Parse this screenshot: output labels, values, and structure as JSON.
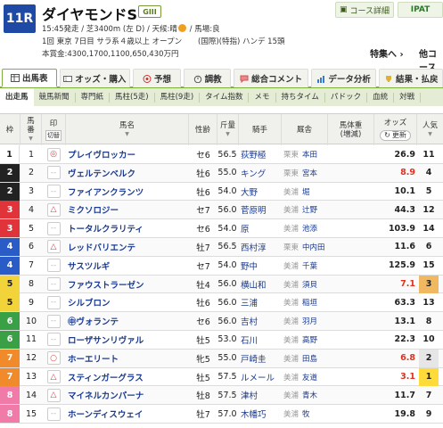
{
  "race": {
    "number": "11R",
    "name": "ダイヤモンドS",
    "grade": "GIII",
    "post_time": "15:45発走",
    "course": "芝3400m (左 D)",
    "weather_label": "天候:晴",
    "track": "馬場:良",
    "meeting": "1回 東京 7日目 サラ系４歳以上 オープン",
    "conditions": "(国際)(特指) ハンデ 15頭",
    "prize": "本賞金:4300,1700,1100,650,430万円"
  },
  "buttons": {
    "course_detail": "コース詳細",
    "ipat": "IPAT",
    "special_link": "特集へ",
    "results_link": "他コース"
  },
  "tabs": [
    {
      "label": "出馬表",
      "icon": "table-icon"
    },
    {
      "label": "オッズ・購入",
      "icon": "ticket-icon"
    },
    {
      "label": "予想",
      "icon": "target-icon"
    },
    {
      "label": "調教",
      "icon": "stopwatch-icon"
    },
    {
      "label": "総合コメント",
      "icon": "comment-icon"
    },
    {
      "label": "データ分析",
      "icon": "chart-icon"
    },
    {
      "label": "結果・払戻",
      "icon": "trophy-icon"
    }
  ],
  "subtabs": [
    "出走馬",
    "競馬新聞",
    "専門紙",
    "馬柱(5走)",
    "馬柱(9走)",
    "タイム指数",
    "メモ",
    "持ちタイム",
    "パドック",
    "血統",
    "対戦"
  ],
  "columns": {
    "waku": "枠",
    "umaban": "馬番",
    "mark": "印",
    "mark_sub": "切替",
    "horse": "馬名",
    "sex_age": "性齢",
    "weight_carried": "斤量",
    "jockey": "騎手",
    "trainer": "厩舎",
    "body_weight": "馬体重",
    "body_weight_sub": "(増減)",
    "odds": "オッズ",
    "update": "更新",
    "popularity": "人気"
  },
  "waku_colors": {
    "1": "#ffffff",
    "2": "#222222",
    "3": "#e0333a",
    "4": "#2a5cc8",
    "5": "#f2d43a",
    "6": "#3aa046",
    "7": "#f08a2a",
    "8": "#f07aa8"
  },
  "horses": [
    {
      "waku": "1",
      "uma": "1",
      "mark": "◎",
      "name": "プレイヴロッカー",
      "sex": "セ6",
      "kin": "56.5",
      "jockey": "荻野極",
      "area": "栗東",
      "trainer": "本田",
      "odds": "26.9",
      "pop": "11",
      "hot": false
    },
    {
      "waku": "2",
      "uma": "2",
      "mark": "--",
      "name": "ヴェルテンベルク",
      "sex": "牡6",
      "kin": "55.0",
      "jockey": "キング",
      "area": "栗東",
      "trainer": "宮本",
      "odds": "8.9",
      "pop": "4",
      "hot": true
    },
    {
      "waku": "2",
      "uma": "3",
      "mark": "--",
      "name": "ファイアンクランツ",
      "sex": "牡6",
      "kin": "54.0",
      "jockey": "大野",
      "area": "美浦",
      "trainer": "堀",
      "odds": "10.1",
      "pop": "5",
      "hot": false
    },
    {
      "waku": "3",
      "uma": "4",
      "mark": "△",
      "name": "ミクソロジー",
      "sex": "セ7",
      "kin": "56.0",
      "jockey": "菅原明",
      "area": "美浦",
      "trainer": "辻野",
      "odds": "44.3",
      "pop": "12",
      "hot": false
    },
    {
      "waku": "3",
      "uma": "5",
      "mark": "--",
      "name": "トータルクラリティ",
      "sex": "セ6",
      "kin": "54.0",
      "jockey": "原",
      "area": "美浦",
      "trainer": "池添",
      "odds": "103.9",
      "pop": "14",
      "hot": false
    },
    {
      "waku": "4",
      "uma": "6",
      "mark": "△",
      "name": "レッドバリエンテ",
      "sex": "牡7",
      "kin": "56.5",
      "jockey": "西村淳",
      "area": "栗東",
      "trainer": "中内田",
      "odds": "11.6",
      "pop": "6",
      "hot": false
    },
    {
      "waku": "4",
      "uma": "7",
      "mark": "--",
      "name": "サスツルギ",
      "sex": "セ7",
      "kin": "54.0",
      "jockey": "野中",
      "area": "美浦",
      "trainer": "千葉",
      "odds": "125.9",
      "pop": "15",
      "hot": false
    },
    {
      "waku": "5",
      "uma": "8",
      "mark": "--",
      "name": "ファウストラーゼン",
      "sex": "牡4",
      "kin": "56.0",
      "jockey": "横山和",
      "area": "美浦",
      "trainer": "須貝",
      "odds": "7.1",
      "pop": "3",
      "hot": true
    },
    {
      "waku": "5",
      "uma": "9",
      "mark": "--",
      "name": "シルブロン",
      "sex": "牡6",
      "kin": "56.0",
      "jockey": "三浦",
      "area": "美浦",
      "trainer": "稲垣",
      "odds": "63.3",
      "pop": "13",
      "hot": false
    },
    {
      "waku": "6",
      "uma": "10",
      "mark": "--",
      "name": "㊥ヴォランテ",
      "sex": "セ6",
      "kin": "56.0",
      "jockey": "吉村",
      "area": "美浦",
      "trainer": "羽月",
      "odds": "13.1",
      "pop": "8",
      "hot": false
    },
    {
      "waku": "6",
      "uma": "11",
      "mark": "--",
      "name": "ローザサンリヴァル",
      "sex": "牡5",
      "kin": "53.0",
      "jockey": "石川",
      "area": "美浦",
      "trainer": "高野",
      "odds": "22.3",
      "pop": "10",
      "hot": false
    },
    {
      "waku": "7",
      "uma": "12",
      "mark": "○",
      "name": "ホーエリート",
      "sex": "牝5",
      "kin": "55.0",
      "jockey": "戸崎圭",
      "area": "美浦",
      "trainer": "田島",
      "odds": "6.8",
      "pop": "2",
      "hot": true
    },
    {
      "waku": "7",
      "uma": "13",
      "mark": "△",
      "name": "スティンガーグラス",
      "sex": "牡5",
      "kin": "57.5",
      "jockey": "ルメール",
      "area": "美浦",
      "trainer": "友道",
      "odds": "3.1",
      "pop": "1",
      "hot": true
    },
    {
      "waku": "8",
      "uma": "14",
      "mark": "△",
      "name": "マイネルカンパーナ",
      "sex": "牡8",
      "kin": "57.5",
      "jockey": "津村",
      "area": "美浦",
      "trainer": "青木",
      "odds": "11.7",
      "pop": "7",
      "hot": false
    },
    {
      "waku": "8",
      "uma": "15",
      "mark": "--",
      "name": "ホーンディスウェイ",
      "sex": "牡7",
      "kin": "57.0",
      "jockey": "木幡巧",
      "area": "美浦",
      "trainer": "牧",
      "odds": "19.8",
      "pop": "9",
      "hot": false
    }
  ]
}
